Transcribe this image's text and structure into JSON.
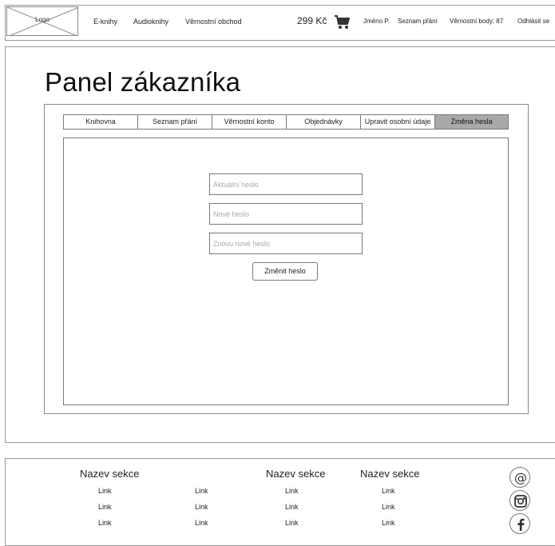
{
  "header": {
    "logo": "Logo",
    "nav": [
      "E-knihy",
      "Audioknihy",
      "Věrnostní obchod"
    ],
    "price": "299 Kč",
    "cart_icon": "cart-icon",
    "user_name": "Jméno P.",
    "wishlist": "Seznam přání",
    "loyalty": "Věrnostní body: 87",
    "logout": "Odhlásit se"
  },
  "page": {
    "title": "Panel zákazníka"
  },
  "tabs": [
    {
      "label": "Knihovna"
    },
    {
      "label": "Seznam přání"
    },
    {
      "label": "Věrnostní konto"
    },
    {
      "label": "Objednávky"
    },
    {
      "label": "Upravit osobní údaje"
    },
    {
      "label": "Změna hesla",
      "active": true
    }
  ],
  "form": {
    "current_password_placeholder": "Aktuální heslo",
    "new_password_placeholder": "Nové heslo",
    "repeat_password_placeholder": "Znovu nové heslo",
    "submit_label": "Změnit heslo"
  },
  "footer": {
    "sections": [
      {
        "title": "Nazev sekce",
        "links": [
          "Link",
          "Link",
          "Link"
        ]
      },
      {
        "title": "",
        "links": [
          "Link",
          "Link",
          "Link"
        ]
      },
      {
        "title": "Nazev sekce",
        "links": [
          "Link",
          "Link",
          "Link"
        ]
      },
      {
        "title": "Nazev sekce",
        "links": [
          "Link",
          "Link",
          "Link"
        ]
      }
    ],
    "social_icons": [
      "email-icon",
      "instagram-icon",
      "facebook-icon"
    ]
  }
}
